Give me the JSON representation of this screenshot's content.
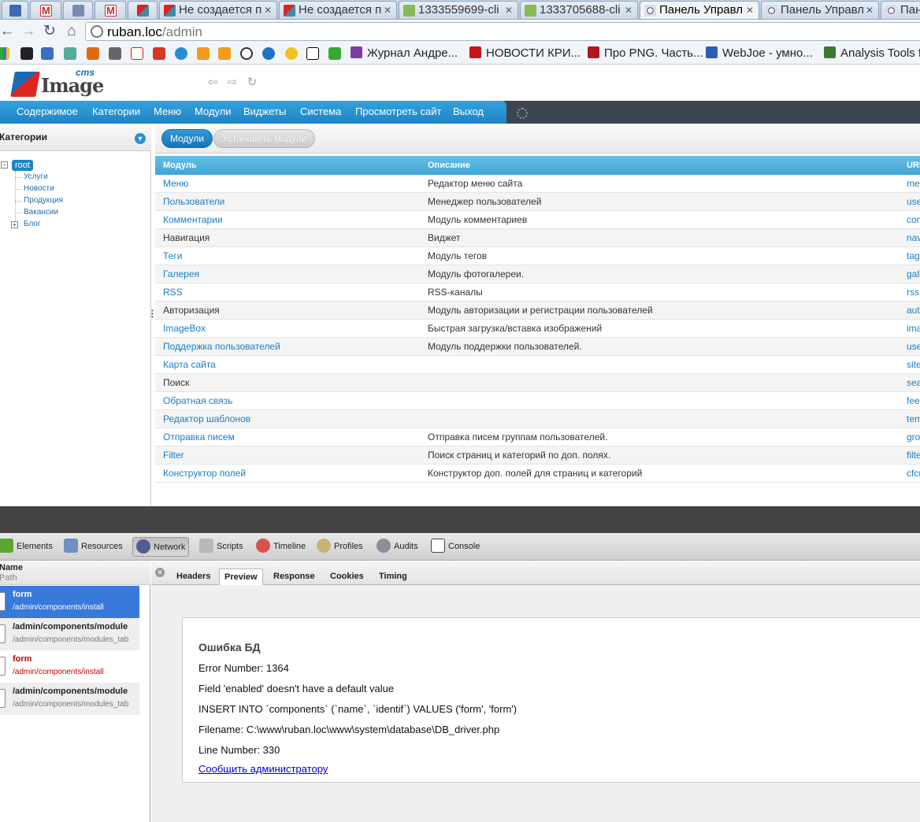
{
  "browser": {
    "tabs": [
      {
        "title": "",
        "icon": "play-icon",
        "active": false
      },
      {
        "title": "",
        "icon": "gmail-icon",
        "active": false
      },
      {
        "title": "",
        "icon": "disk-icon",
        "active": false
      },
      {
        "title": "",
        "icon": "gmail-icon",
        "active": false
      },
      {
        "title": "",
        "icon": "flag-icon",
        "active": false
      },
      {
        "title": "Не создается п",
        "icon": "flag-icon",
        "active": false
      },
      {
        "title": "Не создается п",
        "icon": "flag-icon",
        "active": false
      },
      {
        "title": "1333559699-cli",
        "icon": "upload-icon",
        "active": false
      },
      {
        "title": "1333705688-cli",
        "icon": "upload-icon",
        "active": false
      },
      {
        "title": "Панель Управл",
        "icon": "globe-icon",
        "active": true
      },
      {
        "title": "Панель Управл",
        "icon": "globe-icon",
        "active": false
      },
      {
        "title": "Панел",
        "icon": "globe-icon",
        "active": false
      }
    ],
    "url_host": "ruban.loc",
    "url_path": "/admin",
    "bookmarks": [
      {
        "label": "Журнал Андре...",
        "color": "#7a3ea1"
      },
      {
        "label": "НОВОСТИ КРИ...",
        "color": "#c3151a"
      },
      {
        "label": "Про PNG. Часть...",
        "color": "#b0171c"
      },
      {
        "label": "WebJoe - умно...",
        "color": "#2a5fb4"
      },
      {
        "label": "Analysis Tools f",
        "color": "#3b7a2e"
      }
    ]
  },
  "cms": {
    "logo_cms": "cms",
    "logo_word": "Image",
    "menu": [
      "Содержимое",
      "Категории",
      "Меню",
      "Модули",
      "Виджеты",
      "Система",
      "Просмотреть сайт",
      "Выход"
    ],
    "left_title": "Категории",
    "tree": {
      "root": "root",
      "children": [
        "Услуги",
        "Новости",
        "Продукция",
        "Вакансии",
        "Блог"
      ]
    },
    "tab_modules": "Модули",
    "tab_install": "Установить модули",
    "table": {
      "headers": [
        "Модуль",
        "Описание",
        "URL"
      ],
      "rows": [
        {
          "name": "Меню",
          "desc": "Редактор меню сайта",
          "url": "menu",
          "link": true
        },
        {
          "name": "Пользователи",
          "desc": "Менеджер пользователей",
          "url": "user_manager",
          "link": true
        },
        {
          "name": "Комментарии",
          "desc": "Модуль комментариев",
          "url": "comments",
          "link": true
        },
        {
          "name": "Навигация",
          "desc": "Виджет",
          "url": "navigation",
          "link": false
        },
        {
          "name": "Теги",
          "desc": "Модуль тегов",
          "url": "tags",
          "link": true
        },
        {
          "name": "Галерея",
          "desc": "Модуль фотогалереи.",
          "url": "gallery",
          "link": true
        },
        {
          "name": "RSS",
          "desc": "RSS-каналы",
          "url": "rss",
          "link": true
        },
        {
          "name": "Авторизация",
          "desc": "Модуль авторизации и регистрации пользователей",
          "url": "auth",
          "link": false
        },
        {
          "name": "ImageBox",
          "desc": "Быстрая загрузка/вставка изображений",
          "url": "imagebox",
          "link": true
        },
        {
          "name": "Поддержка пользователей",
          "desc": "Модуль поддержки пользователей.",
          "url": "user_support",
          "link": true
        },
        {
          "name": "Карта сайта",
          "desc": "",
          "url": "sitemap",
          "link": true
        },
        {
          "name": "Поиск",
          "desc": "",
          "url": "search",
          "link": false
        },
        {
          "name": "Обратная связь",
          "desc": "",
          "url": "feedback",
          "link": true
        },
        {
          "name": "Редактор шаблонов",
          "desc": "",
          "url": "template_editor",
          "link": true
        },
        {
          "name": "Отправка писем",
          "desc": "Отправка писем группам пользователей.",
          "url": "group_mail",
          "link": true
        },
        {
          "name": "Filter",
          "desc": "Поиск страниц и категорий по доп. полях.",
          "url": "filter",
          "link": true
        },
        {
          "name": "Конструктор полей",
          "desc": "Конструктор доп. полей для страниц и категорий",
          "url": "cfcm",
          "link": true
        }
      ]
    }
  },
  "devtools": {
    "tools": [
      "Elements",
      "Resources",
      "Network",
      "Scripts",
      "Timeline",
      "Profiles",
      "Audits",
      "Console"
    ],
    "list_head_name": "Name",
    "list_head_path": "Path",
    "requests": [
      {
        "name": "form",
        "path": "/admin/components/install",
        "state": "sel"
      },
      {
        "name": "/admin/components/module",
        "path": "/admin/components/modules_tab",
        "state": "normal"
      },
      {
        "name": "form",
        "path": "/admin/components/install",
        "state": "err"
      },
      {
        "name": "/admin/components/module",
        "path": "/admin/components/modules_tab",
        "state": "normal"
      }
    ],
    "detail_tabs": [
      "Headers",
      "Preview",
      "Response",
      "Cookies",
      "Timing"
    ],
    "error": {
      "title": "Ошибка БД",
      "error_number": "Error Number: 1364",
      "message": "Field 'enabled' doesn't have a default value",
      "query": "INSERT INTO `components` (`name`, `identif`) VALUES ('form', 'form')",
      "filename": "Filename: C:\\www\\ruban.loc\\www\\system\\database\\DB_driver.php",
      "line_number": "Line Number: 330",
      "report_link": "Сообщить администратору"
    }
  }
}
